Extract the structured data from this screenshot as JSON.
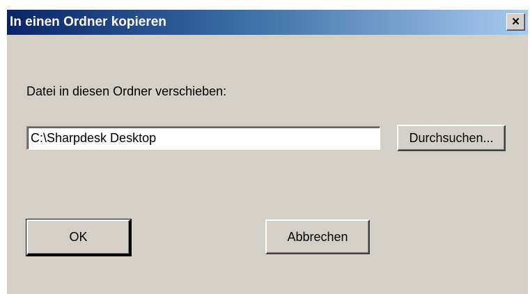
{
  "window": {
    "title": "In einen Ordner kopieren",
    "close_label": "×"
  },
  "form": {
    "prompt": "Datei in diesen Ordner verschieben:",
    "folder_path": "C:\\Sharpdesk Desktop",
    "browse_label": "Durchsuchen..."
  },
  "buttons": {
    "ok_label": "OK",
    "cancel_label": "Abbrechen"
  }
}
